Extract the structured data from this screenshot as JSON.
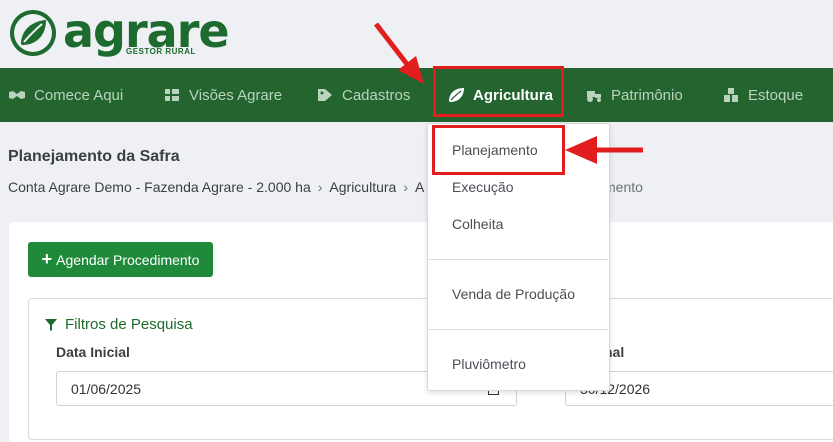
{
  "brand": {
    "name": "agrare",
    "tagline": "GESTOR RURAL",
    "color": "#1d6b2e"
  },
  "nav": {
    "items": [
      {
        "label": "Comece Aqui",
        "icon": "handshake-icon"
      },
      {
        "label": "Visões Agrare",
        "icon": "grid-icon"
      },
      {
        "label": "Cadastros",
        "icon": "tag-icon"
      },
      {
        "label": "Agricultura",
        "icon": "leaf-icon",
        "active": true
      },
      {
        "label": "Patrimônio",
        "icon": "tractor-icon"
      },
      {
        "label": "Estoque",
        "icon": "boxes-icon"
      }
    ],
    "background": "#24652f"
  },
  "page": {
    "title": "Planejamento da Safra",
    "breadcrumb": [
      "Conta Agrare Demo - Fazenda Agrare - 2.000 ha",
      "Agricultura",
      "A"
    ],
    "breadcrumb_tail": "mento"
  },
  "dropdown": {
    "items": [
      "Planejamento",
      "Execução",
      "Colheita",
      "Venda de Produção",
      "Pluviômetro"
    ],
    "highlighted": "Planejamento"
  },
  "actions": {
    "agendar_label": "Agendar Procedimento"
  },
  "filters": {
    "title": "Filtros de Pesquisa",
    "start_label": "Data Inicial",
    "start_value": "01/06/2025",
    "end_label": "nal",
    "end_value": "30/12/2026"
  },
  "annotation_color": "#e21d1d"
}
